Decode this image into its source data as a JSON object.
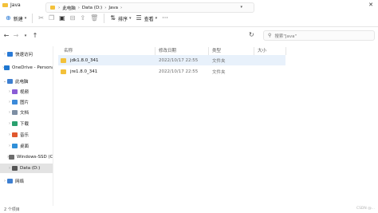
{
  "window": {
    "title": "Java",
    "close_glyph": "✕"
  },
  "toolbar": {
    "new_label": "新建",
    "sort_label": "排序",
    "view_label": "查看",
    "more_glyph": "···"
  },
  "nav": {
    "breadcrumb": [
      "此电脑",
      "Data (D:)",
      "Java"
    ],
    "search_placeholder": "搜索\"Java\""
  },
  "sidebar": {
    "items": [
      {
        "label": "快速访问",
        "icon": "star-icon",
        "color": "#2a7ad6",
        "expanded": false
      },
      {
        "label": "OneDrive - Persona",
        "icon": "cloud-icon",
        "color": "#1f77d0",
        "expanded": false
      },
      {
        "label": "此电脑",
        "icon": "computer-icon",
        "color": "#3d7fd1",
        "expanded": true
      },
      {
        "label": "视频",
        "icon": "video-icon",
        "color": "#8a5cd6",
        "expanded": false
      },
      {
        "label": "图片",
        "icon": "pictures-icon",
        "color": "#3b8ad9",
        "expanded": false
      },
      {
        "label": "文档",
        "icon": "documents-icon",
        "color": "#7d8ea3",
        "expanded": false
      },
      {
        "label": "下载",
        "icon": "download-icon",
        "color": "#2aa06e",
        "expanded": false
      },
      {
        "label": "音乐",
        "icon": "music-icon",
        "color": "#e0582f",
        "expanded": false
      },
      {
        "label": "桌面",
        "icon": "desktop-icon",
        "color": "#2f8fd8",
        "expanded": false
      },
      {
        "label": "Windows-SSD (C:)",
        "icon": "drive-icon",
        "color": "#6d6d6d",
        "expanded": false
      },
      {
        "label": "Data (D:)",
        "icon": "drive-icon",
        "color": "#555555",
        "expanded": false,
        "selected": true
      },
      {
        "label": "网络",
        "icon": "network-icon",
        "color": "#3d7fd1",
        "expanded": false
      }
    ]
  },
  "columns": [
    "名称",
    "修改日期",
    "类型",
    "大小"
  ],
  "files": [
    {
      "name": "jdk1.8.0_341",
      "modified": "2022/10/17 22:55",
      "type": "文件夹",
      "size": "",
      "selected": true
    },
    {
      "name": "jre1.8.0_341",
      "modified": "2022/10/17 22:55",
      "type": "文件夹",
      "size": "",
      "selected": false
    }
  ],
  "status": {
    "item_count": "2 个项目"
  },
  "watermark": "CSDN @..."
}
